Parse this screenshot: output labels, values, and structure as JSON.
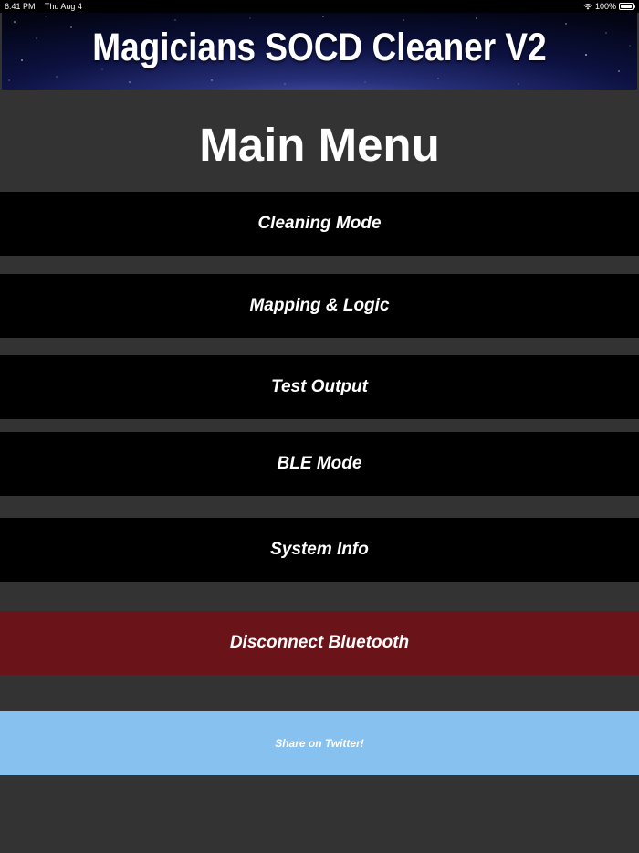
{
  "status_bar": {
    "time": "6:41 PM",
    "date": "Thu Aug 4",
    "battery": "100%"
  },
  "banner": {
    "title": "Magicians SOCD Cleaner V2"
  },
  "page": {
    "title": "Main Menu"
  },
  "menu": {
    "cleaning_mode": "Cleaning Mode",
    "mapping_logic": "Mapping & Logic",
    "test_output": "Test Output",
    "ble_mode": "BLE Mode",
    "system_info": "System Info",
    "disconnect_bluetooth": "Disconnect Bluetooth",
    "share_twitter": "Share on Twitter!"
  },
  "colors": {
    "background": "#333333",
    "menu_button": "#000000",
    "danger_button": "#6a1419",
    "share_button": "#87c1ef"
  }
}
